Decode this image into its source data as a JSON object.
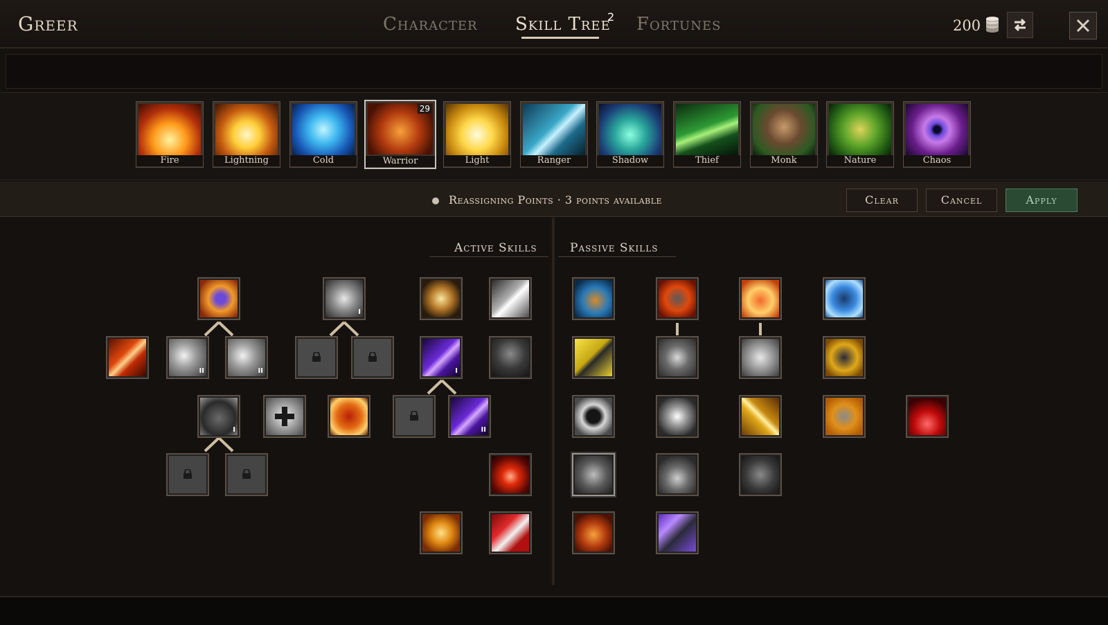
{
  "character": {
    "name": "Greer"
  },
  "tabs": [
    {
      "label": "Character",
      "active": false
    },
    {
      "label": "Skill Tree",
      "active": true,
      "badge": "2"
    },
    {
      "label": "Fortunes",
      "active": false
    }
  ],
  "currency": {
    "amount": "200",
    "icon": "coin-stack-icon"
  },
  "buttons": {
    "swap": "swap-icon",
    "close": "close-icon"
  },
  "classes": [
    {
      "label": "Fire"
    },
    {
      "label": "Lightning"
    },
    {
      "label": "Cold"
    },
    {
      "label": "Warrior",
      "level": "29",
      "selected": true
    },
    {
      "label": "Light"
    },
    {
      "label": "Ranger"
    },
    {
      "label": "Shadow"
    },
    {
      "label": "Thief"
    },
    {
      "label": "Monk"
    },
    {
      "label": "Nature"
    },
    {
      "label": "Chaos"
    }
  ],
  "status": {
    "text": "Reassigning Points · 3 points available",
    "clear": "Clear",
    "cancel": "Cancel",
    "apply": "Apply"
  },
  "sections": {
    "active": "Active Skills",
    "passive": "Passive Skills"
  },
  "active_skills": [
    {
      "icon": "axe-swirl-icon",
      "rank": ""
    },
    {
      "icon": "whirlwind-icon",
      "rank": "I"
    },
    {
      "icon": "hammer-burst-icon",
      "rank": ""
    },
    {
      "icon": "blade-slash-icon",
      "rank": ""
    },
    {
      "icon": "fire-slash-icon",
      "rank": ""
    },
    {
      "icon": "cleave-icon",
      "rank": "II"
    },
    {
      "icon": "cleave-icon",
      "rank": "II"
    },
    {
      "icon": "locked-skill-icon",
      "rank": ""
    },
    {
      "icon": "locked-skill-icon",
      "rank": ""
    },
    {
      "icon": "purple-blade-icon",
      "rank": "I"
    },
    {
      "icon": "spirit-hands-icon",
      "rank": ""
    },
    {
      "icon": "spiked-helm-icon",
      "rank": "I"
    },
    {
      "icon": "cross-heal-icon",
      "rank": ""
    },
    {
      "icon": "flame-body-icon",
      "rank": ""
    },
    {
      "icon": "locked-skill-icon",
      "rank": ""
    },
    {
      "icon": "purple-blade-icon",
      "rank": "II"
    },
    {
      "icon": "locked-skill-icon",
      "rank": ""
    },
    {
      "icon": "locked-skill-icon",
      "rank": ""
    },
    {
      "icon": "blood-drop-icon",
      "rank": ""
    },
    {
      "icon": "flaming-fist-icon",
      "rank": ""
    },
    {
      "icon": "bloody-axe-icon",
      "rank": ""
    }
  ],
  "passive_skills": [
    {
      "icon": "winged-boot-icon",
      "rank": ""
    },
    {
      "icon": "fire-hammer-icon",
      "rank": ""
    },
    {
      "icon": "flaming-shield-icon",
      "rank": ""
    },
    {
      "icon": "blue-shield-icon",
      "rank": ""
    },
    {
      "icon": "gold-hammer-icon",
      "rank": ""
    },
    {
      "icon": "grey-hammer-icon",
      "rank": ""
    },
    {
      "icon": "grey-armor-icon",
      "rank": ""
    },
    {
      "icon": "gauntlet-icon",
      "rank": ""
    },
    {
      "icon": "fangs-icon",
      "rank": ""
    },
    {
      "icon": "impact-icon",
      "rank": ""
    },
    {
      "icon": "golden-spear-icon",
      "rank": ""
    },
    {
      "icon": "crossed-swords-icon",
      "rank": ""
    },
    {
      "icon": "blood-pool-icon",
      "rank": ""
    },
    {
      "icon": "beast-head-icon",
      "rank": ""
    },
    {
      "icon": "water-orb-icon",
      "rank": ""
    },
    {
      "icon": "iron-fist-icon",
      "rank": ""
    },
    {
      "icon": "berserker-icon",
      "rank": ""
    },
    {
      "icon": "shadow-knight-icon",
      "rank": ""
    }
  ]
}
